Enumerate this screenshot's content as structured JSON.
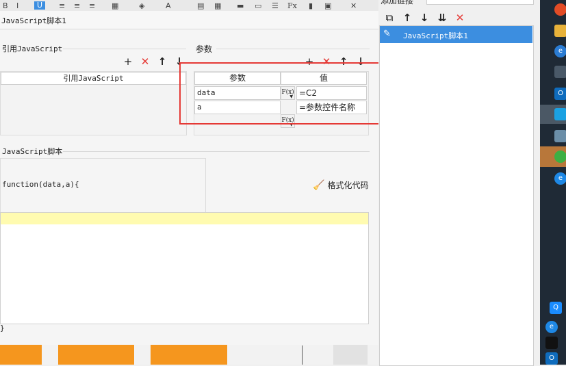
{
  "window": {
    "title": "JavaScript脚本1"
  },
  "top_toolbar": {
    "top_right_label": "添加链接"
  },
  "imports": {
    "section_label": "引用JavaScript",
    "column_header": "引用JavaScript",
    "rows": []
  },
  "params": {
    "section_label": "参数",
    "columns": [
      "参数",
      "值"
    ],
    "fx_label": "F(x)",
    "rows": [
      {
        "name": "data",
        "value": "=C2"
      },
      {
        "name": "a",
        "value": "=参数控件名称"
      }
    ],
    "highlight_color": "#e53935"
  },
  "script": {
    "section_label": "JavaScript脚本",
    "signature": "function(data,a){",
    "format_button_label": "格式化代码",
    "closing_brace": "}",
    "current_line_color": "#fffbb0"
  },
  "right_panel": {
    "items": [
      {
        "label": "JavaScript脚本1",
        "selected": true
      }
    ]
  },
  "icons": {
    "add": "plus-icon",
    "delete": "delete-x-icon",
    "up": "arrow-up-icon",
    "down": "arrow-down-icon",
    "copy": "copy-icon",
    "move_bottom": "move-to-bottom-icon",
    "edit": "pencil-icon",
    "broom": "broom-icon"
  },
  "colors": {
    "accent_blue": "#3c8ee0",
    "delete_red": "#e53935",
    "orange": "#f5961e"
  }
}
